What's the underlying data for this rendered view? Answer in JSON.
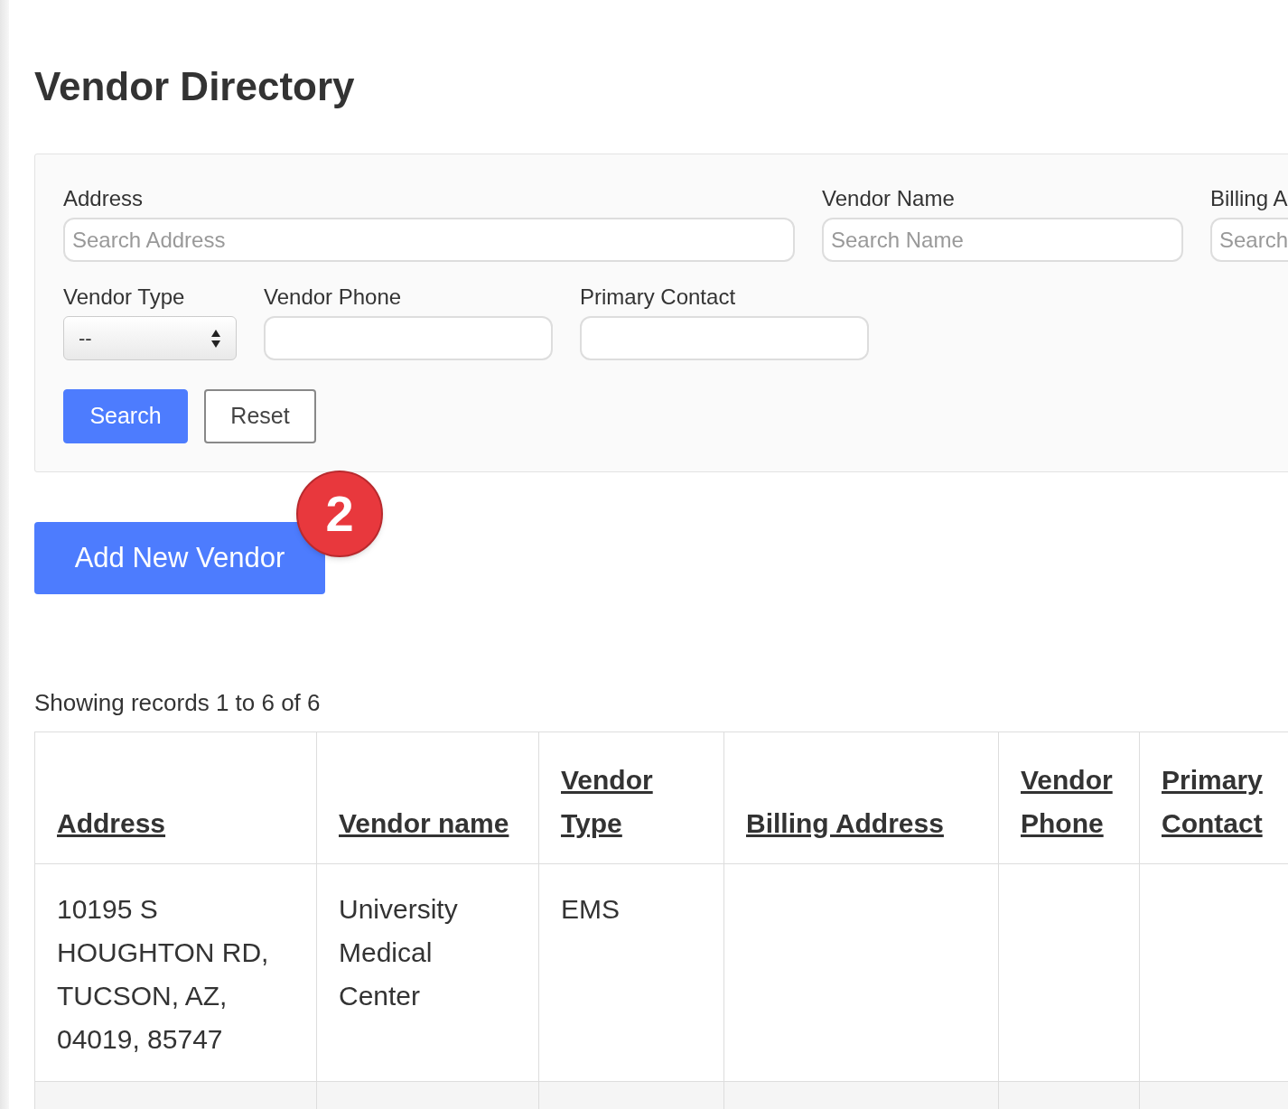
{
  "page": {
    "title": "Vendor Directory"
  },
  "filters": {
    "fields": [
      {
        "kind": "text",
        "label": "Address",
        "placeholder": "Search Address"
      },
      {
        "kind": "text",
        "label": "Vendor Name",
        "placeholder": "Search Name"
      },
      {
        "kind": "text",
        "label": "Billing A",
        "placeholder": "Search"
      },
      {
        "kind": "select",
        "label": "Vendor Type",
        "value": "--"
      },
      {
        "kind": "text",
        "label": "Vendor Phone"
      },
      {
        "kind": "text",
        "label": "Primary Contact"
      }
    ],
    "buttons": [
      {
        "kind": "primary",
        "label": "Search"
      },
      {
        "kind": "secondary",
        "label": "Reset"
      }
    ]
  },
  "add_button": {
    "label": "Add New Vendor",
    "badge": "2"
  },
  "records_summary": "Showing records 1 to 6 of 6",
  "table": {
    "columns": [
      "Address",
      "Vendor name",
      "Vendor Type",
      "Billing Address",
      "Vendor Phone",
      "Primary Contact"
    ],
    "rows": [
      {
        "cells": [
          "10195 S HOUGHTON RD, TUCSON, AZ, 04019, 85747",
          "University Medical Center",
          "EMS",
          "",
          "",
          ""
        ]
      }
    ]
  }
}
